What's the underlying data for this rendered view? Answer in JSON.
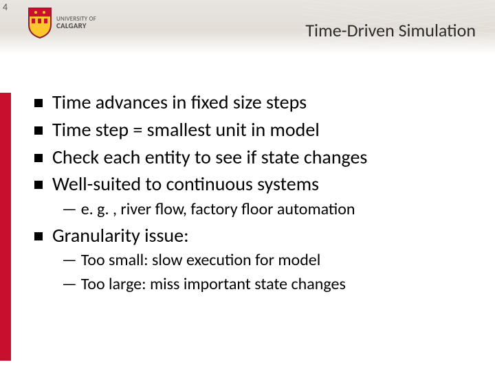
{
  "page_number": "4",
  "logo": {
    "line1": "UNIVERSITY OF",
    "line2": "CALGARY"
  },
  "title": "Time-Driven Simulation",
  "bullets": {
    "b1": "Time advances in fixed size steps",
    "b2": "Time step = smallest unit in model",
    "b3": "Check each entity to see if state changes",
    "b4": "Well-suited to continuous systems",
    "b4_sub1_prefix": "e. g. , ",
    "b4_sub1_rest": "river flow, factory floor automation",
    "b5": "Granularity issue:",
    "b5_sub1": "Too small: slow execution for model",
    "b5_sub2": "Too large: miss important state changes"
  },
  "dash": "—"
}
